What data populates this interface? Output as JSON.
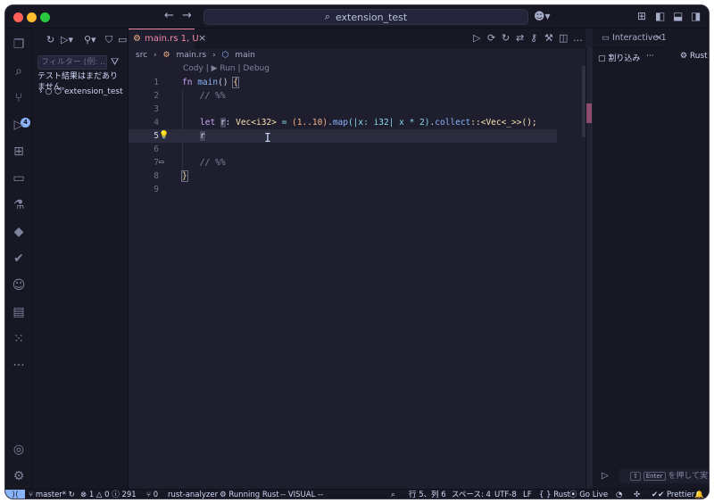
{
  "window": {
    "title": "extension_test"
  },
  "titlebar": {
    "back": "←",
    "forward": "→",
    "search_glyph": "⌕"
  },
  "activity": {
    "items": [
      {
        "name": "explorer-icon",
        "glyph": "❐"
      },
      {
        "name": "search-icon",
        "glyph": "⌕"
      },
      {
        "name": "source-control-icon",
        "glyph": "⑂"
      },
      {
        "name": "run-debug-icon",
        "glyph": "▷"
      },
      {
        "name": "extensions-icon",
        "glyph": "⊞"
      },
      {
        "name": "remote-explorer-icon",
        "glyph": "▭"
      },
      {
        "name": "testing-icon",
        "glyph": "⚗"
      },
      {
        "name": "docker-icon",
        "glyph": "◆"
      },
      {
        "name": "check-icon",
        "glyph": "✔"
      },
      {
        "name": "copilot-icon",
        "glyph": "☺"
      },
      {
        "name": "notebook-icon",
        "glyph": "▤"
      },
      {
        "name": "grid-icon",
        "glyph": "⁙"
      },
      {
        "name": "more-icon",
        "glyph": "···"
      }
    ],
    "badge": "4",
    "account_glyph": "◎",
    "settings_glyph": "⚙"
  },
  "sidebar": {
    "filter_placeholder": "フィルター (例: ...",
    "no_results": "テスト結果はまだありません。",
    "tree_item": "extension_test"
  },
  "tab": {
    "label": "main.rs 1, U",
    "icon_glyph": "⚙",
    "close_glyph": "×"
  },
  "breadcrumb": {
    "folder": "src",
    "file": "main.rs",
    "symbol": "main"
  },
  "codelens": "Cody | ▶ Run | Debug",
  "code": {
    "line_numbers": [
      "1",
      "2",
      "3",
      "4",
      "5",
      "6",
      "7",
      "8",
      "9"
    ],
    "l1": {
      "kw": "fn",
      "name": "main",
      "open": "() ",
      "brace": "{"
    },
    "l2": "// %%",
    "l4": {
      "let": "let",
      "var": "r",
      "colon": ": ",
      "type": "Vec<i32>",
      "eq": " = ",
      "range": "(1..10)",
      "dot1": ".",
      "map": "map",
      "closure": "(|x: i32| x * 2)",
      "dot2": ".",
      "collect": "collect",
      "turbo": "::<Vec<_>>();"
    },
    "l5": "r",
    "l7": "// %%",
    "l8": "}"
  },
  "right_panel": {
    "tab": "Interactive-1",
    "interrupt": "割り込み",
    "more": "···",
    "kernel": "Rust",
    "input_hint": "を押して実",
    "enter_key": "Enter"
  },
  "statusbar": {
    "remote_glyph": "⟩⟨",
    "branch": "master*",
    "problems": "⊗ 1 △ 0 ⓘ 291",
    "ports": "⑂ 0",
    "analyzer": "rust-analyzer",
    "running": "Running Rust",
    "mode": "-- VISUAL --",
    "position": "行 5、列 6",
    "spaces": "スペース: 4",
    "encoding": "UTF-8",
    "eol": "LF",
    "language": "{ } Rust",
    "golive": "Go Live",
    "prettier": "Prettier"
  }
}
